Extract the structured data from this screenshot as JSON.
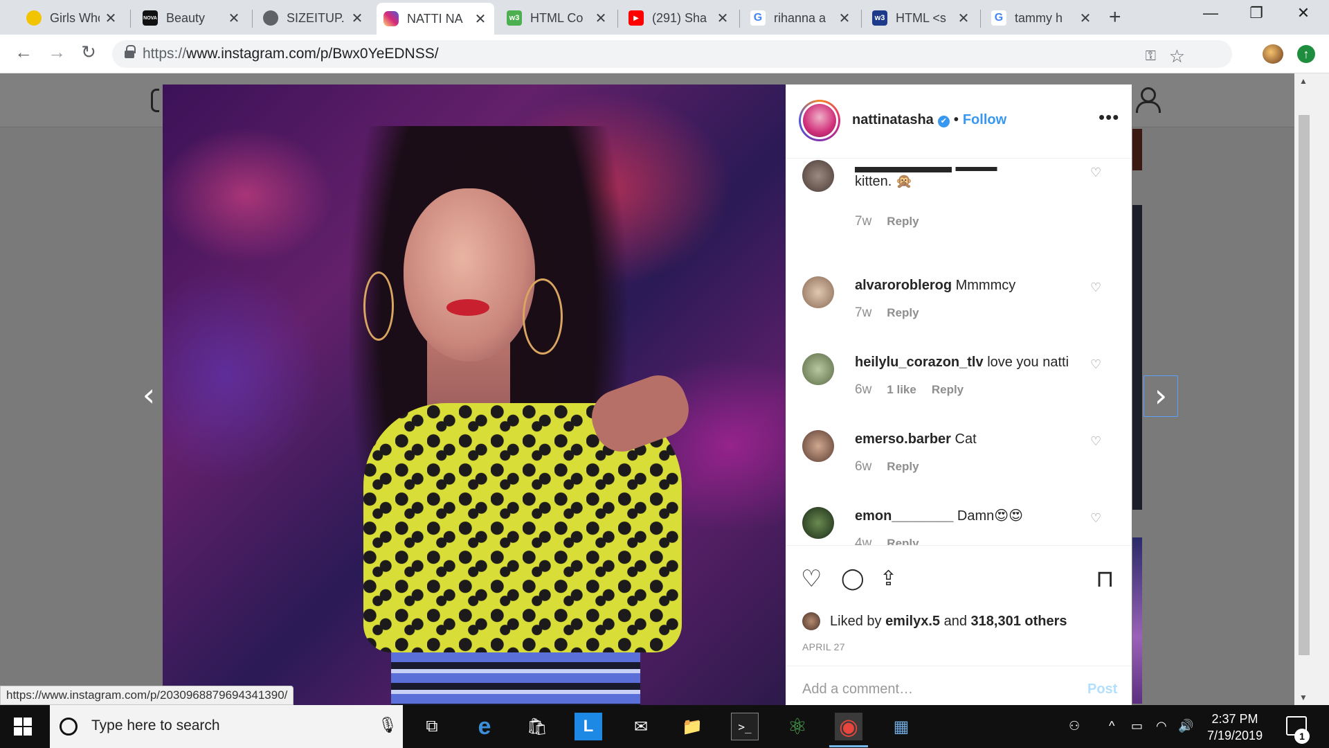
{
  "browser": {
    "tabs": [
      {
        "title": "Girls Who",
        "favicon": "yellow-round-icon",
        "color": "#f2c400"
      },
      {
        "title": "Beauty",
        "favicon": "nova-icon",
        "color": "#111111",
        "text": "NOVA"
      },
      {
        "title": "SIZEITUP.",
        "favicon": "globe-icon",
        "color": "#5f6368"
      },
      {
        "title": "NATTI NA",
        "favicon": "instagram-icon",
        "color": "#d62976",
        "active": true
      },
      {
        "title": "HTML Co",
        "favicon": "w3-icon",
        "color": "#4caf50",
        "text": "w3"
      },
      {
        "title": "(291) Sha",
        "favicon": "youtube-icon",
        "color": "#ff0000",
        "text": "▶"
      },
      {
        "title": "rihanna a",
        "favicon": "google-icon",
        "color": "#4285f4",
        "text": "G"
      },
      {
        "title": "HTML <s",
        "favicon": "w3c-icon",
        "color": "#1e3a8a",
        "text": "w3"
      },
      {
        "title": "tammy h",
        "favicon": "google-icon",
        "color": "#4285f4",
        "text": "G"
      }
    ],
    "close_glyph": "✕",
    "new_tab_glyph": "+",
    "window_controls": {
      "minimize": "—",
      "restore": "❐",
      "close": "✕"
    },
    "nav": {
      "back": "←",
      "forward": "→",
      "reload": "↻"
    },
    "url_protocol": "https://",
    "url_rest": "www.instagram.com/p/Bwx0YeEDNSS/",
    "key_glyph": "⚿",
    "star_glyph": "☆",
    "update_glyph": "↑"
  },
  "page": {
    "prev_arrow": "‹",
    "next_arrow": "›"
  },
  "post": {
    "username": "nattinatasha",
    "verified_glyph": "✔",
    "separator": "•",
    "follow_label": "Follow",
    "more_glyph": "•••",
    "comments": [
      {
        "username": "",
        "text": "kitten. 🙊",
        "time": "7w",
        "likes": "",
        "reply": "Reply",
        "avatar_color": "#7a6a60"
      },
      {
        "username": "alvaroroblerog",
        "text": "Mmmmcy",
        "time": "7w",
        "likes": "",
        "reply": "Reply",
        "avatar_color": "#c9a98a"
      },
      {
        "username": "heilylu_corazon_tlv",
        "text": "love you natti",
        "time": "6w",
        "likes": "1 like",
        "reply": "Reply",
        "avatar_color": "#8aa070"
      },
      {
        "username": "emerso.barber",
        "text": "Cat",
        "time": "6w",
        "likes": "",
        "reply": "Reply",
        "avatar_color": "#9a7a6a"
      },
      {
        "username": "emon________",
        "text": "Damn😍😍",
        "time": "4w",
        "likes": "",
        "reply": "Reply",
        "avatar_color": "#4a6a3a"
      }
    ],
    "heart_glyph": "♡",
    "actions": {
      "like": "♡",
      "comment": "◯",
      "share": "⇪",
      "save": "⊓"
    },
    "liked_by_prefix": "Liked by",
    "liked_by_user": "emilyx.5",
    "liked_by_mid": "and",
    "liked_by_others": "318,301 others",
    "date": "APRIL 27",
    "comment_placeholder": "Add a comment…",
    "post_button": "Post"
  },
  "status_bar_url": "https://www.instagram.com/p/2030968879694341390/",
  "taskbar": {
    "search_placeholder": "Type here to search",
    "mic_glyph": "🎙",
    "apps": [
      {
        "name": "task-view",
        "glyph": "⧉"
      },
      {
        "name": "edge",
        "glyph": "e",
        "color": "#3b8ed8"
      },
      {
        "name": "store",
        "glyph": "🛍"
      },
      {
        "name": "l-app",
        "glyph": "L",
        "color": "#1e88e5"
      },
      {
        "name": "mail",
        "glyph": "✉"
      },
      {
        "name": "file-explorer",
        "glyph": "📁"
      },
      {
        "name": "terminal",
        "glyph": ">_"
      },
      {
        "name": "atom",
        "glyph": "⚛",
        "color": "#4caf50"
      },
      {
        "name": "chrome",
        "glyph": "◉",
        "color": "#e8453c",
        "active": true
      },
      {
        "name": "photos",
        "glyph": "▦",
        "color": "#6fa8dc"
      }
    ],
    "tray": {
      "people": "⚇",
      "chevron": "^",
      "battery": "▭",
      "wifi": "◠",
      "volume": "🔊"
    },
    "time": "2:37 PM",
    "date": "7/19/2019",
    "notification_count": "1"
  }
}
